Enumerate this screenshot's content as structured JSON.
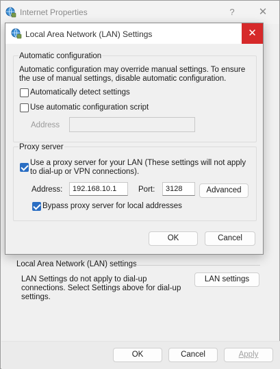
{
  "parent_window": {
    "title": "Internet Properties",
    "help_glyph": "?",
    "close_glyph": "✕",
    "lan_section": {
      "heading": "Local Area Network (LAN) settings",
      "description": "LAN Settings do not apply to dial-up connections. Select Settings above for dial-up settings.",
      "lan_settings_button": "LAN settings"
    },
    "footer": {
      "ok_label": "OK",
      "cancel_label": "Cancel",
      "apply_label": "Apply"
    }
  },
  "dialog": {
    "title": "Local Area Network (LAN) Settings",
    "close_glyph": "✕",
    "automatic_configuration": {
      "legend": "Automatic configuration",
      "description": "Automatic configuration may override manual settings.  To ensure the use of manual settings, disable automatic configuration.",
      "auto_detect_label": "Automatically detect settings",
      "auto_detect_checked": false,
      "auto_script_label": "Use automatic configuration script",
      "auto_script_checked": false,
      "address_label": "Address",
      "address_value": ""
    },
    "proxy_server": {
      "legend": "Proxy server",
      "use_proxy_label": "Use a proxy server for your LAN (These settings will not apply to dial-up or VPN connections).",
      "use_proxy_checked": true,
      "address_label": "Address:",
      "address_value": "192.168.10.1",
      "port_label": "Port:",
      "port_value": "3128",
      "advanced_label": "Advanced",
      "bypass_label": "Bypass proxy server for local addresses",
      "bypass_checked": true
    },
    "ok_label": "OK",
    "cancel_label": "Cancel"
  },
  "colors": {
    "close_button": "#d6292a",
    "checkbox_checked": "#2a6ec3"
  },
  "icons": {
    "title_icon": "internet-globe-icon"
  }
}
